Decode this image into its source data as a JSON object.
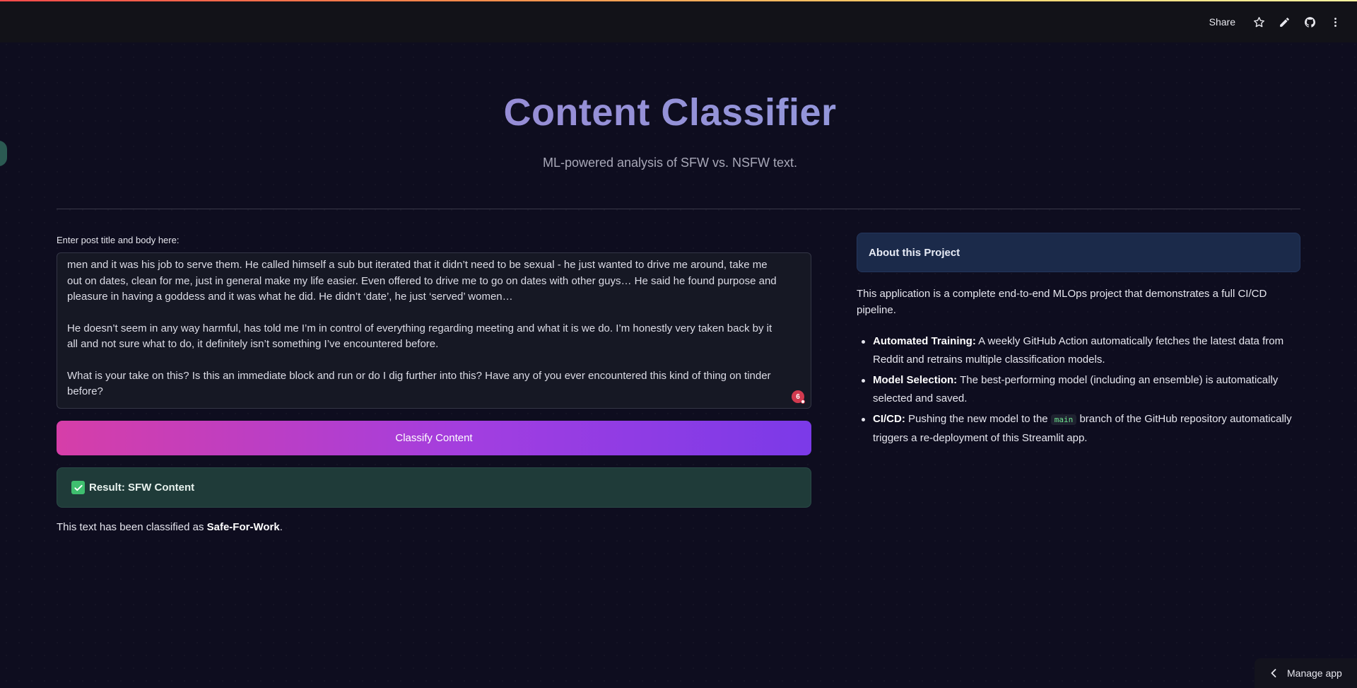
{
  "header": {
    "share_label": "Share",
    "icons": [
      "star-icon",
      "pencil-icon",
      "github-icon",
      "kebab-menu-icon"
    ]
  },
  "hero": {
    "title": "Content Classifier",
    "subtitle": "ML-powered analysis of SFW vs. NSFW text."
  },
  "input": {
    "label": "Enter post title and body here:",
    "paragraphs": [
      "men and it was his job to serve them. He called himself a sub but iterated that it didn’t need to be sexual - he just wanted to drive me around, take me out on dates, clean for me, just in general make my life easier. Even offered to drive me to go on dates with other guys… He said he found purpose and pleasure in having a goddess and it was what he did. He didn’t ‘date’, he just ‘served’ women…",
      "He doesn’t seem in any way harmful, has told me I’m in control of everything regarding meeting and what it is we do. I’m honestly very taken back by it all and not sure what to do, it definitely isn’t something I’ve encountered before.",
      "What is your take on this? Is this an immediate block and run or do I dig further into this? Have any of you ever encountered this kind of thing on tinder before?"
    ],
    "badge_count": "6"
  },
  "classify_button": {
    "label": "Classify Content"
  },
  "result": {
    "title": "Result: SFW Content",
    "note_prefix": "This text has been classified as ",
    "note_bold": "Safe-For-Work",
    "note_suffix": "."
  },
  "about": {
    "title": "About this Project",
    "description": "This application is a complete end-to-end MLOps project that demonstrates a full CI/CD pipeline.",
    "items": [
      {
        "bold": "Automated Training:",
        "text": " A weekly GitHub Action automatically fetches the latest data from Reddit and retrains multiple classification models."
      },
      {
        "bold": "Model Selection:",
        "text": " The best-performing model (including an ensemble) is automatically selected and saved."
      },
      {
        "bold": "CI/CD:",
        "text_before": " Pushing the new model to the ",
        "code": "main",
        "text_after": " branch of the GitHub repository automatically triggers a re-deployment of this Streamlit app."
      }
    ]
  },
  "footer": {
    "manage_label": "Manage app"
  },
  "colors": {
    "background": "#0e0d1f",
    "accent_pink": "#d63ea8",
    "accent_purple": "#7b3ae8",
    "success": "#3fbf6f",
    "info_bg": "#1b2a4a"
  }
}
